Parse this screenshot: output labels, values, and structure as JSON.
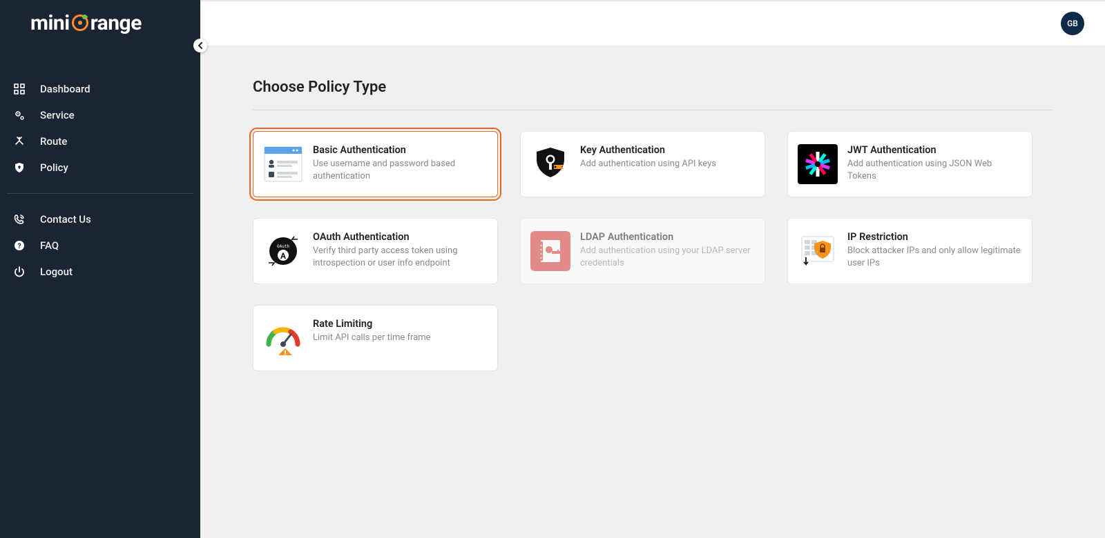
{
  "brand": {
    "name_a": "mini",
    "name_b": "range"
  },
  "user": {
    "initials": "GB"
  },
  "sidebar": {
    "primary": [
      {
        "label": "Dashboard"
      },
      {
        "label": "Service"
      },
      {
        "label": "Route"
      },
      {
        "label": "Policy"
      }
    ],
    "secondary": [
      {
        "label": "Contact Us"
      },
      {
        "label": "FAQ"
      },
      {
        "label": "Logout"
      }
    ]
  },
  "page": {
    "title": "Choose Policy Type"
  },
  "policies": [
    {
      "title": "Basic Authentication",
      "desc": "Use username and password based authentication",
      "selected": true
    },
    {
      "title": "Key Authentication",
      "desc": "Add authentication using API keys"
    },
    {
      "title": "JWT Authentication",
      "desc": "Add authentication using JSON Web Tokens"
    },
    {
      "title": "OAuth Authentication",
      "desc": "Verify third party access token using introspection or user info endpoint"
    },
    {
      "title": "LDAP Authentication",
      "desc": "Add authentication using your LDAP server credentials",
      "disabled": true
    },
    {
      "title": "IP Restriction",
      "desc": "Block attacker IPs and only allow legitimate user IPs"
    },
    {
      "title": "Rate Limiting",
      "desc": "Limit API calls per time frame"
    }
  ]
}
